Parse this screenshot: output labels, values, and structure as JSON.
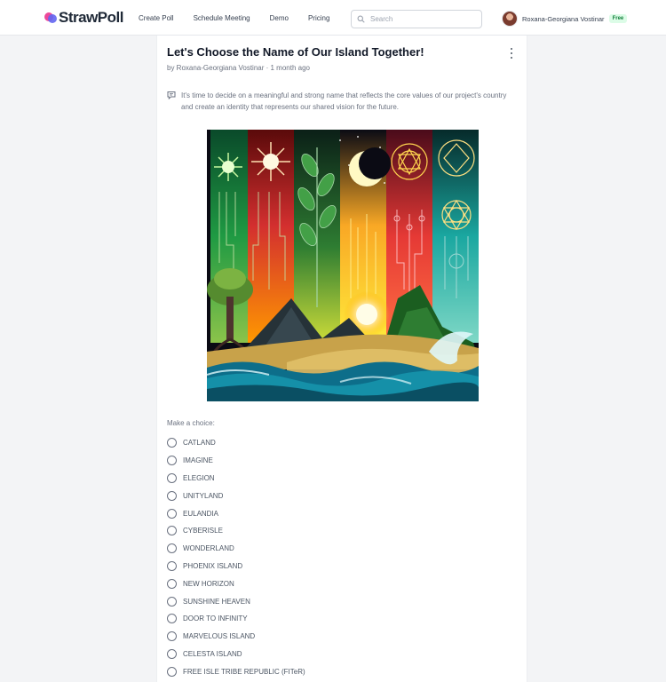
{
  "app": {
    "logo": "StrawPoll",
    "nav": [
      "Create Poll",
      "Schedule Meeting",
      "Demo",
      "Pricing"
    ],
    "search_placeholder": "Search",
    "user": {
      "name": "Roxana-Georgiana Vostinar",
      "plan": "Free"
    }
  },
  "poll": {
    "title": "Let's Choose the Name of Our Island Together!",
    "meta": "by Roxana-Georgiana Vostinar · 1 month ago",
    "description": "It's time to decide on a meaningful and strong name that reflects the core values of our project's country and create an identity that represents our shared vision for the future.",
    "choice_prompt": "Make a choice:",
    "options": [
      "CATLAND",
      "IMAGINE",
      "ELEGION",
      "UNITYLAND",
      "EULANDIA",
      "CYBERISLE",
      "WONDERLAND",
      "PHOENIX ISLAND",
      "NEW HORIZON",
      "SUNSHINE HEAVEN",
      "DOOR TO INFINITY",
      "MARVELOUS ISLAND",
      "CELESTA ISLAND",
      "FREE ISLE TRIBE REPUBLIC (FITeR)"
    ]
  },
  "colors": {
    "accent": "#6366f1",
    "brand_pink": "#ec4899",
    "badge_green": "#15803d"
  },
  "icons": [
    "search-icon",
    "kebab-menu-icon",
    "description-icon",
    "radio-icon"
  ]
}
